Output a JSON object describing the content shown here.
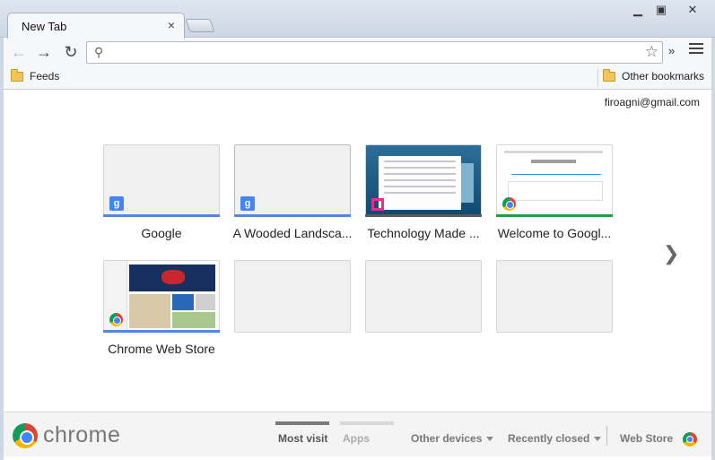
{
  "window": {
    "tab_title": "New Tab",
    "tab_close": "×",
    "minimize": "▁",
    "maximize": "▣",
    "close": "✕"
  },
  "toolbar": {
    "back": "←",
    "forward": "→",
    "reload": "↻",
    "search_icon": "⚲",
    "omnibox_value": "",
    "star": "☆",
    "extensions_chevron": "»"
  },
  "bookmarks": {
    "left_folder": "Feeds",
    "right_folder": "Other bookmarks"
  },
  "account": "firoagni@gmail.com",
  "tiles": [
    {
      "label": "Google",
      "bar_color": "#4a8ae6",
      "favicon": "g-icon",
      "favicon_text": "g"
    },
    {
      "label": "A Wooded Landsca...",
      "bar_color": "#4a8ae6",
      "favicon": "g-icon",
      "favicon_text": "g"
    },
    {
      "label": "Technology Made ...",
      "bar_color": "#5a5a5a",
      "favicon": "e-icon"
    },
    {
      "label": "Welcome to Googl...",
      "bar_color": "#1fa040",
      "favicon": "chrome-icon"
    },
    {
      "label": "Chrome Web Store",
      "bar_color": "#4a8ae6",
      "favicon": "chrome-icon"
    }
  ],
  "next_arrow": "❯",
  "footer": {
    "logo_text": "chrome",
    "most_visited": "Most visit",
    "apps": "Apps",
    "other_devices": "Other devices",
    "recently_closed": "Recently closed",
    "web_store": "Web Store"
  }
}
